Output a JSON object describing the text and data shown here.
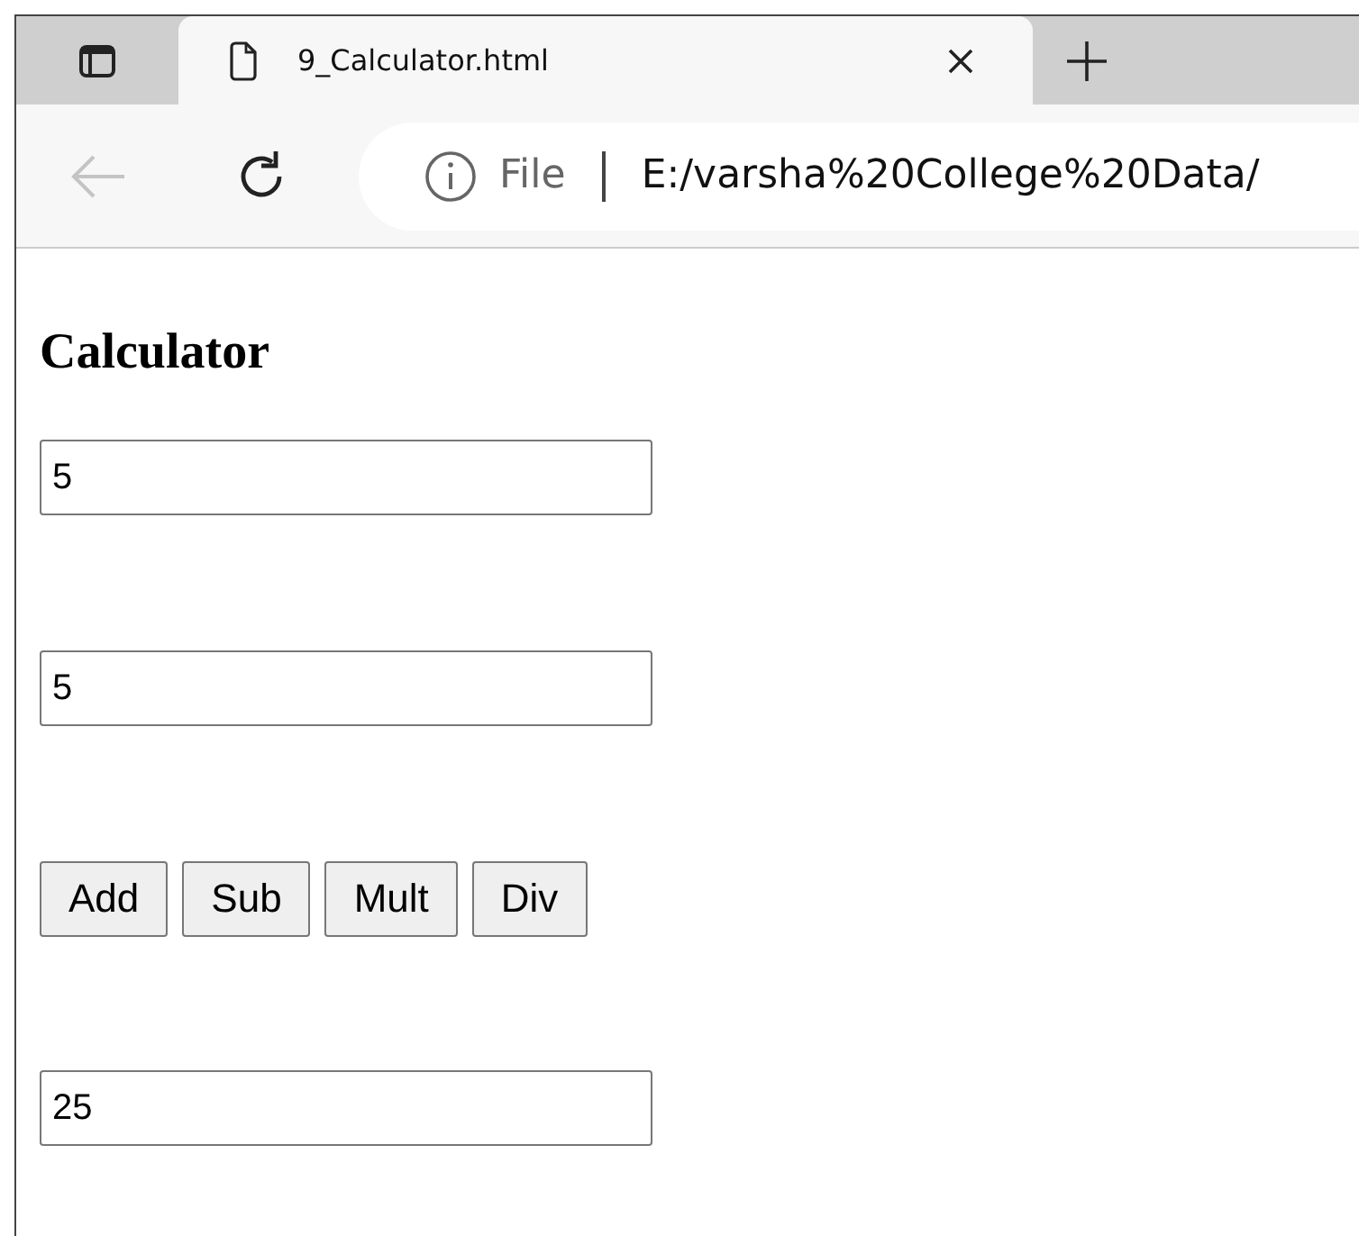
{
  "tab": {
    "title": "9_Calculator.html",
    "selected": true
  },
  "toolbar": {
    "back_disabled": true,
    "scheme": "File",
    "address": "E:/varsha%20College%20Data/"
  },
  "page": {
    "heading": "Calculator",
    "fields": [
      {
        "value": "5"
      },
      {
        "value": "5"
      }
    ],
    "buttons": [
      "Add",
      "Sub",
      "Mult",
      "Div"
    ],
    "result": {
      "value": "25"
    }
  }
}
